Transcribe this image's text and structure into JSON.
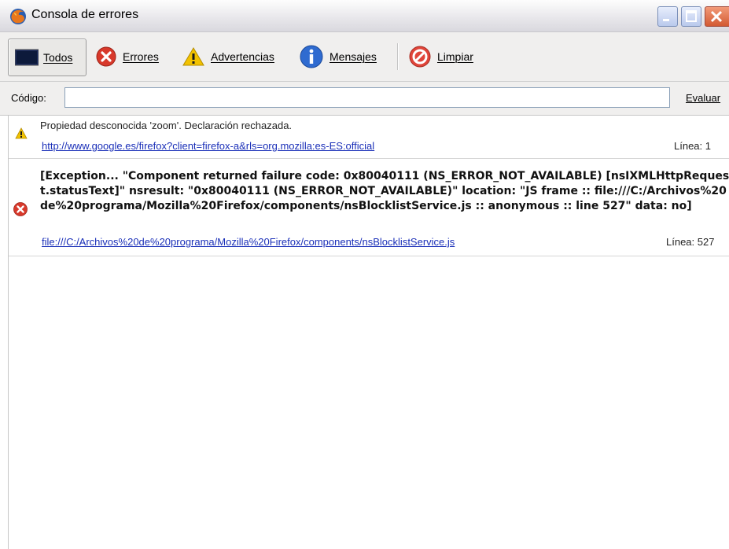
{
  "window": {
    "title": "Consola de errores",
    "controls": [
      "minimize-icon",
      "maximize-icon",
      "close-icon"
    ]
  },
  "toolbar": {
    "buttons": [
      {
        "label": "Todos",
        "icon": "console-all-icon",
        "selected": true
      },
      {
        "label": "Errores",
        "icon": "error-icon",
        "selected": false
      },
      {
        "label": "Advertencias",
        "icon": "warning-icon",
        "selected": false
      },
      {
        "label": "Mensajes",
        "icon": "info-icon",
        "selected": false
      },
      {
        "label": "Limpiar",
        "icon": "clear-icon",
        "selected": false
      }
    ]
  },
  "codebar": {
    "label": "Código:",
    "input_value": "",
    "evaluate_label": "Evaluar"
  },
  "entries": [
    {
      "type": "warning",
      "icon": "warning-icon",
      "message": "Propiedad desconocida 'zoom'.  Declaración rechazada.",
      "source": "http://www.google.es/firefox?client=firefox-a&rls=org.mozilla:es-ES:official",
      "line": "Línea:  1"
    },
    {
      "type": "error",
      "icon": "error-icon",
      "message": "[Exception... \"Component returned failure code: 0x80040111 (NS_ERROR_NOT_AVAILABLE) [nsIXMLHttpRequest.statusText]\"  nsresult: \"0x80040111 (NS_ERROR_NOT_AVAILABLE)\"  location: \"JS frame :: file:///C:/Archivos%20de%20programa/Mozilla%20Firefox/components/nsBlocklistService.js :: anonymous :: line 527\"  data: no]",
      "source": "file:///C:/Archivos%20de%20programa/Mozilla%20Firefox/components/nsBlocklistService.js",
      "line": "Línea:  527"
    }
  ],
  "colors": {
    "link": "#1a2fb8",
    "error": "#d8392b",
    "warning": "#f2c200",
    "info": "#2f6bd0"
  }
}
